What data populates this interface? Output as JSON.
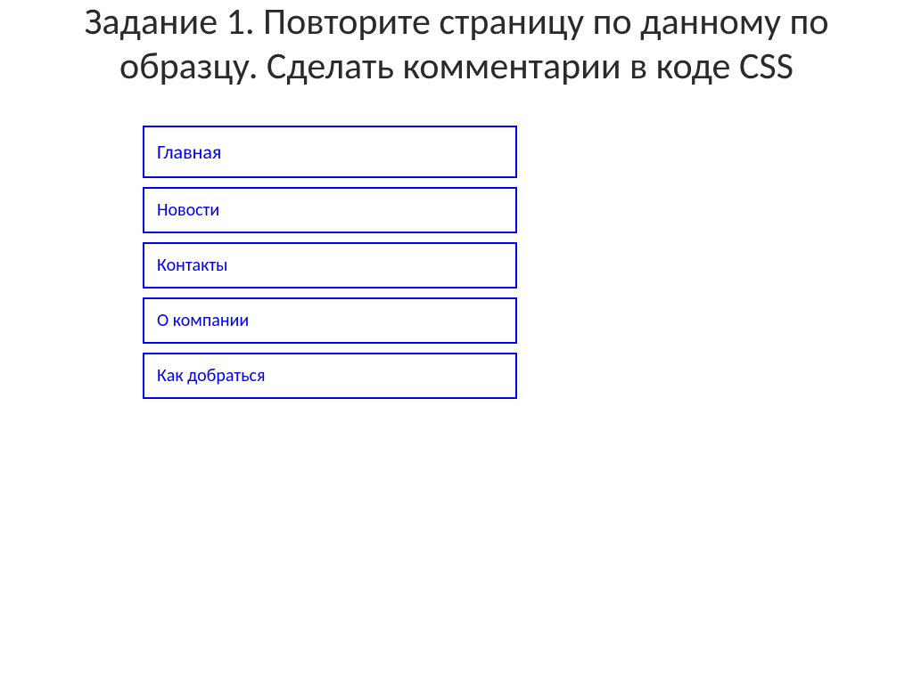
{
  "heading": "Задание 1. Повторите страницу по данному по образцу. Сделать комментарии в коде CSS",
  "menu": {
    "items": [
      {
        "label": "Главная"
      },
      {
        "label": "Новости"
      },
      {
        "label": "Контакты"
      },
      {
        "label": "О компании"
      },
      {
        "label": "Как добраться"
      }
    ]
  }
}
